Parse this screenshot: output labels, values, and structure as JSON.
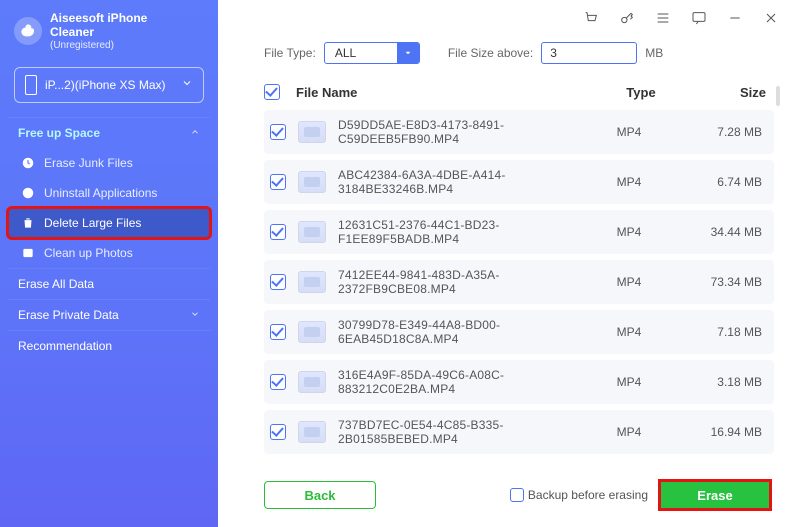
{
  "brand": {
    "line1": "Aiseesoft iPhone",
    "line2": "Cleaner",
    "status": "(Unregistered)"
  },
  "device": {
    "label": "iP...2)(iPhone XS Max)"
  },
  "sidebar": {
    "group1": {
      "title": "Free up Space"
    },
    "items": [
      {
        "label": "Erase Junk Files"
      },
      {
        "label": "Uninstall Applications"
      },
      {
        "label": "Delete Large Files"
      },
      {
        "label": "Clean up Photos"
      }
    ],
    "eraseAll": "Erase All Data",
    "erasePrivate": "Erase Private Data",
    "recommendation": "Recommendation"
  },
  "filters": {
    "fileTypeLabel": "File Type:",
    "fileTypeValue": "ALL",
    "fileSizeLabel": "File Size above:",
    "fileSizeValue": "3",
    "unit": "MB"
  },
  "columns": {
    "name": "File Name",
    "type": "Type",
    "size": "Size"
  },
  "files": [
    {
      "name": "D59DD5AE-E8D3-4173-8491-C59DEEB5FB90.MP4",
      "type": "MP4",
      "size": "7.28 MB"
    },
    {
      "name": "ABC42384-6A3A-4DBE-A414-3184BE33246B.MP4",
      "type": "MP4",
      "size": "6.74 MB"
    },
    {
      "name": "12631C51-2376-44C1-BD23-F1EE89F5BADB.MP4",
      "type": "MP4",
      "size": "34.44 MB"
    },
    {
      "name": "7412EE44-9841-483D-A35A-2372FB9CBE08.MP4",
      "type": "MP4",
      "size": "73.34 MB"
    },
    {
      "name": "30799D78-E349-44A8-BD00-6EAB45D18C8A.MP4",
      "type": "MP4",
      "size": "7.18 MB"
    },
    {
      "name": "316E4A9F-85DA-49C6-A08C-883212C0E2BA.MP4",
      "type": "MP4",
      "size": "3.18 MB"
    },
    {
      "name": "737BD7EC-0E54-4C85-B335-2B01585BEBED.MP4",
      "type": "MP4",
      "size": "16.94 MB"
    }
  ],
  "footer": {
    "back": "Back",
    "backupLabel": "Backup before erasing",
    "erase": "Erase"
  }
}
